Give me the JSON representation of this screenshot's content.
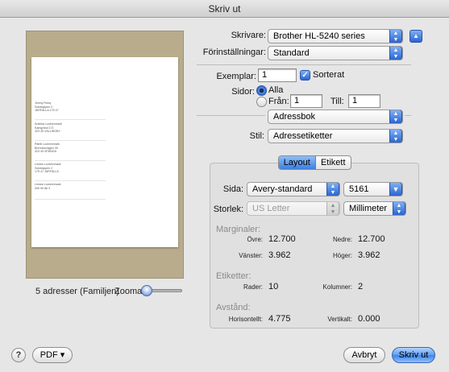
{
  "window": {
    "title": "Skriv ut"
  },
  "preview": {
    "labels": [
      [
        "Jimmy Rönq",
        "Solstrappen 2",
        "JÄRFÄLLA 175 47"
      ],
      [
        "Kristina Loufvenmark",
        "Kamgränd 171",
        "323 45 VÄLLINGBY"
      ],
      [
        "Patrik Loufvenmark",
        "Brennivsvägen 35",
        "323 45 SPÅNGA"
      ],
      [
        "Linnea Loufvenmark",
        "Solstrappen 2",
        "175 47 JÄRFÄLLA"
      ],
      [
        "Linnea Loufvenmark",
        "090 90 86 3"
      ]
    ],
    "summary": "5 adresser (Familjen)",
    "zoom_label": "Zooma:",
    "zoom_level": 0.15
  },
  "form": {
    "printer_label": "Skrivare:",
    "printer_value": "Brother HL-5240 series",
    "presets_label": "Förinställningar:",
    "presets_value": "Standard",
    "copies_label": "Exemplar:",
    "copies_value": "1",
    "collate_label": "Sorterat",
    "collate_checked": true,
    "pages_label": "Sidor:",
    "pages_all_label": "Alla",
    "pages_from_label": "Från:",
    "pages_from_value": "1",
    "pages_to_label": "Till:",
    "pages_to_value": "1",
    "panel_value": "Adressbok",
    "style_label": "Stil:",
    "style_value": "Adressetiketter"
  },
  "tabs": [
    {
      "label": "Layout",
      "selected": true
    },
    {
      "label": "Etikett",
      "selected": false
    }
  ],
  "layout": {
    "page_label": "Sida:",
    "page_value": "Avery-standard",
    "page_code": "5161",
    "size_label": "Storlek:",
    "size_value": "US Letter",
    "unit_value": "Millimeter",
    "margins_title": "Marginaler:",
    "margin_top_label": "Övre:",
    "margin_top_value": "12.700",
    "margin_bottom_label": "Nedre:",
    "margin_bottom_value": "12.700",
    "margin_left_label": "Vänster:",
    "margin_left_value": "3.962",
    "margin_right_label": "Höger:",
    "margin_right_value": "3.962",
    "labels_title": "Etiketter:",
    "rows_label": "Rader:",
    "rows_value": "10",
    "cols_label": "Kolumner:",
    "cols_value": "2",
    "spacing_title": "Avstånd:",
    "horizontal_label": "Horisontellt:",
    "horizontal_value": "4.775",
    "vertical_label": "Vertikalt:",
    "vertical_value": "0.000"
  },
  "footer": {
    "help_glyph": "?",
    "pdf_label": "PDF ▾",
    "cancel_label": "Avbryt",
    "print_label": "Skriv ut"
  },
  "colors": {
    "accent": "#2a65d1",
    "preview_bg": "#b8ac8c"
  }
}
